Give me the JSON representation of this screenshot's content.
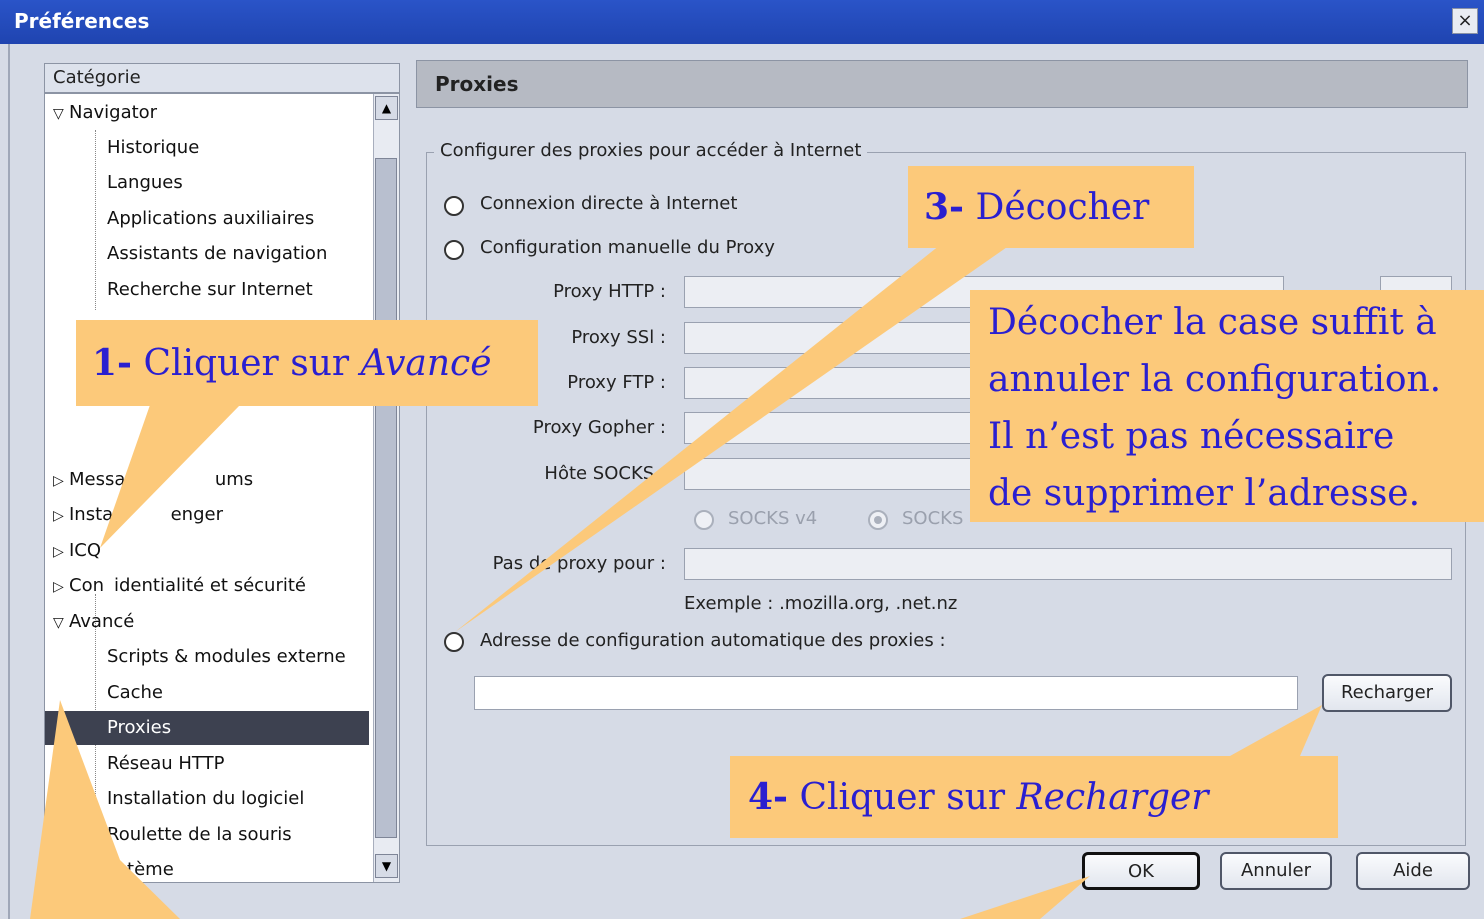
{
  "window": {
    "title": "Préférences",
    "close_label": "×"
  },
  "sidebar": {
    "header": "Catégorie",
    "items": [
      {
        "label": "Navigator",
        "level": 0,
        "expanded": true
      },
      {
        "label": "Historique",
        "level": 1
      },
      {
        "label": "Langues",
        "level": 1
      },
      {
        "label": "Applications auxiliaires",
        "level": 1
      },
      {
        "label": "Assistants de navigation",
        "level": 1
      },
      {
        "label": "Recherche sur Internet",
        "level": 1
      },
      {
        "label": "Messag",
        "suffix": "ums",
        "level": 0,
        "expanded": false
      },
      {
        "label": "Instan",
        "suffix": "enger",
        "level": 0,
        "expanded": false
      },
      {
        "label": "ICQ",
        "level": 0,
        "expanded": false
      },
      {
        "label": "Con",
        "suffix": "identialité et sécurité",
        "level": 0,
        "expanded": false
      },
      {
        "label": "Avancé",
        "level": 0,
        "expanded": true
      },
      {
        "label": "Scripts & modules externe",
        "level": 1
      },
      {
        "label": "Cache",
        "level": 1
      },
      {
        "label": "Proxies",
        "level": 1,
        "selected": true
      },
      {
        "label": "Réseau HTTP",
        "level": 1
      },
      {
        "label": "Installation du logiciel",
        "level": 1
      },
      {
        "label": "Roulette de la souris",
        "level": 1
      },
      {
        "label": "ystème",
        "level": 1
      }
    ]
  },
  "panel": {
    "title": "Proxies",
    "group_label": "Configurer des proxies pour accéder à Internet",
    "radio_direct": "Connexion directe à Internet",
    "radio_manual": "Configuration manuelle du Proxy",
    "proxy_http": "Proxy HTTP :",
    "proxy_ssl": "Proxy SSl :",
    "proxy_ftp": "Proxy FTP :",
    "proxy_gopher": "Proxy Gopher :",
    "socks_host": "Hôte SOCKS :",
    "socks_v4": "SOCKS v4",
    "socks_v5": "SOCKS",
    "no_proxy_label": "Pas de proxy pour :",
    "example": "Exemple : .mozilla.org, .net.nz",
    "radio_auto": "Adresse de configuration automatique des proxies :",
    "reload_button": "Recharger",
    "auto_url_value": ""
  },
  "buttons": {
    "ok": "OK",
    "cancel": "Annuler",
    "help": "Aide"
  },
  "callouts": {
    "c1_num": "1-",
    "c1_text": "Cliquer sur ",
    "c1_em": "Avancé",
    "c3_num": "3-",
    "c3_text": "Décocher",
    "note_lines": [
      "Décocher la case suffit à",
      "annuler la configuration.",
      "Il n’est pas nécessaire",
      "de supprimer l’adresse."
    ],
    "c4_num": "4-",
    "c4_text": "Cliquer sur ",
    "c4_em": "Recharger"
  },
  "colors": {
    "callout_bg": "#fcc97a",
    "callout_text": "#2a1fd0",
    "selected_row": "#3d4150",
    "titlebar": "#2a54c8"
  }
}
